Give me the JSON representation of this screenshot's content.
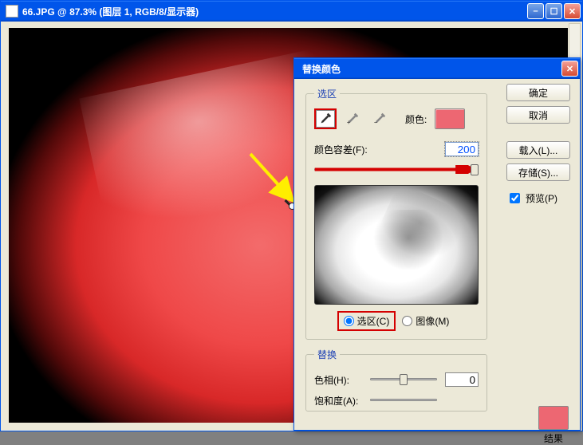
{
  "document": {
    "title": "66.JPG @ 87.3% (图层 1, RGB/8/显示器)"
  },
  "dialog": {
    "title": "替换颜色",
    "selection": {
      "legend": "选区",
      "color_label": "颜色:",
      "sample_color": "#ed6772",
      "fuzziness_label": "颜色容差(F):",
      "fuzziness_value": "200",
      "radio_selection": "选区(C)",
      "radio_image": "图像(M)"
    },
    "replacement": {
      "legend": "替换",
      "hue_label": "色相(H):",
      "hue_value": "0",
      "sat_label": "饱和度(A):",
      "sat_value": "",
      "result_label": "结果",
      "result_color": "#ed6772"
    },
    "buttons": {
      "ok": "确定",
      "cancel": "取消",
      "load": "载入(L)...",
      "save": "存储(S)...",
      "preview": "预览(P)"
    }
  }
}
